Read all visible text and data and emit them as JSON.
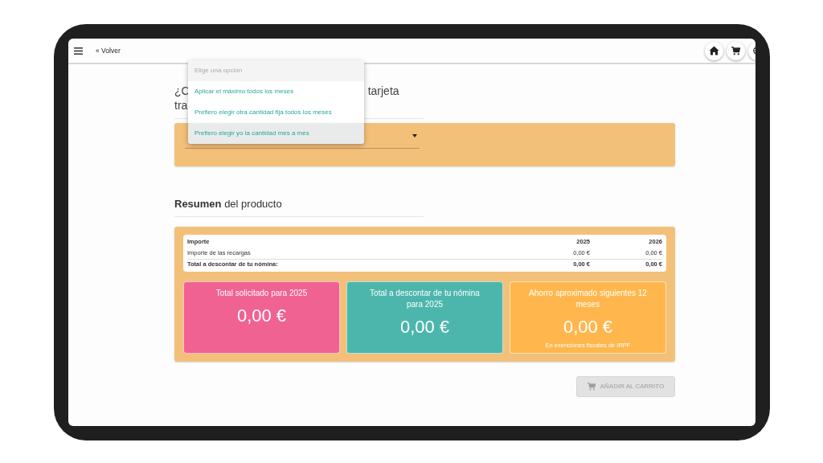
{
  "navbar": {
    "back_link": "« Volver"
  },
  "question": {
    "start": "¿C",
    "end": "tarjeta",
    "second_line": "tra"
  },
  "dropdown": {
    "placeholder": "Elige una opción",
    "options": [
      {
        "label": "Aplicar el máximo todos los meses",
        "selected": false
      },
      {
        "label": "Prefiero elegir otra cantidad fija todos los meses",
        "selected": false
      },
      {
        "label": "Prefiero elegir yo la cantidad mes a mes",
        "selected": true
      }
    ]
  },
  "summary": {
    "title": "**Resumen** del producto",
    "table": {
      "columns": [
        "Importe",
        "2025",
        "2026"
      ],
      "rows": [
        {
          "kind": "normal",
          "cells": [
            "Importe de las recargas",
            "0,00 €",
            "0,00 €"
          ]
        },
        {
          "kind": "total",
          "cells": [
            "Total a descontar de tu nómina:",
            "0,00 €",
            "0,00 €"
          ]
        }
      ]
    },
    "cards": [
      {
        "title": "Total solicitado para 2025",
        "amount": "0,00 €",
        "color": "#f06292"
      },
      {
        "title": "Total a descontar de tu nómina para 2025",
        "amount": "0,00 €",
        "color": "#4db6ac"
      },
      {
        "title": "Ahorro aproximado siguientes 12 meses",
        "amount": "0,00 €",
        "note": "En exenciones fiscales de IRPF",
        "color": "#ffb74d"
      }
    ]
  },
  "cart_button": {
    "label": "AÑADIR AL CARRITO",
    "disabled": true
  }
}
